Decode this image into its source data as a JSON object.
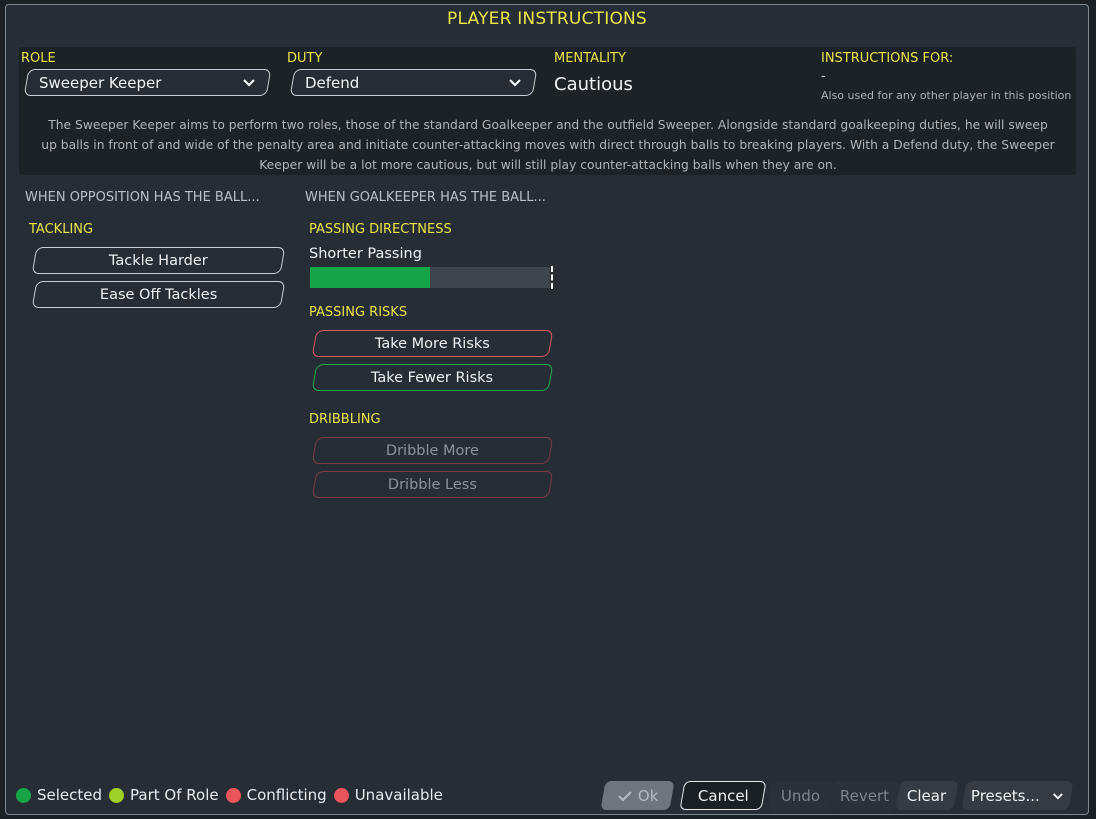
{
  "dialog": {
    "title": "PLAYER INSTRUCTIONS"
  },
  "role": {
    "label": "ROLE",
    "value": "Sweeper Keeper"
  },
  "duty": {
    "label": "DUTY",
    "value": "Defend"
  },
  "mentality": {
    "label": "MENTALITY",
    "value": "Cautious"
  },
  "instructions_for": {
    "label": "INSTRUCTIONS FOR:",
    "value": "-",
    "note": "Also used for any other player in this position"
  },
  "description": "The Sweeper Keeper aims to perform two roles, those of the standard Goalkeeper and the outfield Sweeper. Alongside standard goalkeeping duties, he will sweep up balls in front of and wide of the penalty area and initiate counter-attacking moves with direct through balls to breaking players. With a Defend duty, the Sweeper Keeper will be a lot more cautious, but will still play counter-attacking balls when they are on.",
  "opposition": {
    "heading": "WHEN OPPOSITION HAS THE BALL...",
    "tackling": {
      "heading": "TACKLING",
      "tackle_harder": "Tackle Harder",
      "ease_off": "Ease Off Tackles"
    }
  },
  "goalkeeper": {
    "heading": "WHEN GOALKEEPER HAS THE BALL...",
    "passing_directness": {
      "heading": "PASSING DIRECTNESS",
      "value_label": "Shorter Passing",
      "level": 0.5
    },
    "passing_risks": {
      "heading": "PASSING RISKS",
      "more": "Take More Risks",
      "fewer": "Take Fewer Risks"
    },
    "dribbling": {
      "heading": "DRIBBLING",
      "more": "Dribble More",
      "less": "Dribble Less"
    }
  },
  "legend": [
    {
      "label": "Selected",
      "color": "#16a546"
    },
    {
      "label": "Part Of Role",
      "color": "#9fd026"
    },
    {
      "label": "Conflicting",
      "color": "#e9555a"
    },
    {
      "label": "Unavailable",
      "color": "#e9555a"
    }
  ],
  "footer": {
    "ok": "Ok",
    "cancel": "Cancel",
    "undo": "Undo",
    "revert": "Revert",
    "clear": "Clear",
    "presets": "Presets..."
  },
  "colors": {
    "accent_yellow": "#e9e64a",
    "selected_green": "#16a546",
    "conflict_red": "#d95860"
  }
}
